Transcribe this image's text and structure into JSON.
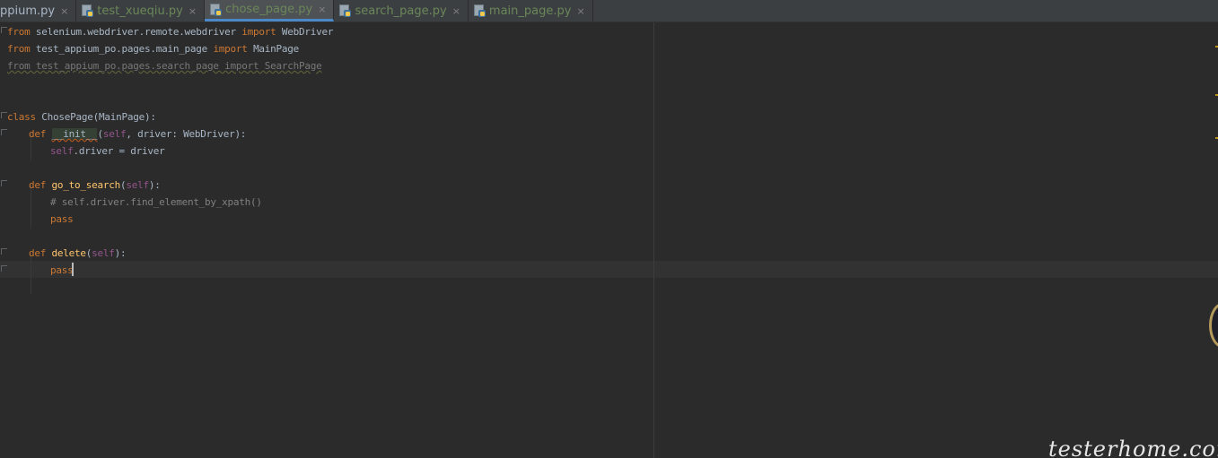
{
  "tabs": [
    {
      "label": "appium.py",
      "active": false,
      "style": "plain"
    },
    {
      "label": "test_xueqiu.py",
      "active": false,
      "style": "green"
    },
    {
      "label": "chose_page.py",
      "active": true,
      "style": "green"
    },
    {
      "label": "search_page.py",
      "active": false,
      "style": "green"
    },
    {
      "label": "main_page.py",
      "active": false,
      "style": "green"
    }
  ],
  "tab_close_glyph": "×",
  "code": {
    "line1": {
      "kw1": "from",
      "module": "selenium.webdriver.remote.webdriver",
      "kw2": "import",
      "name": "WebDriver"
    },
    "line2": {
      "kw1": "from",
      "module": "test_appium_po.pages.main_page",
      "kw2": "import",
      "name": "MainPage"
    },
    "line3": {
      "text": "from test_appium_po.pages.search_page import SearchPage"
    },
    "line6": {
      "kw": "class",
      "name": "ChosePage(MainPage):"
    },
    "line7": {
      "kw": "def",
      "fn": "__init__",
      "open": "(",
      "self": "self",
      "rest": ", driver: WebDriver):"
    },
    "line8": {
      "self": "self",
      "rest": ".driver = driver"
    },
    "line10": {
      "kw": "def",
      "fn": "go_to_search",
      "open": "(",
      "self": "self",
      "close": "):"
    },
    "line11": {
      "comment": "# self.driver.find_element_by_xpath()"
    },
    "line12": {
      "kw": "pass"
    },
    "line14": {
      "kw": "def",
      "fn": "delete",
      "open": "(",
      "self": "self",
      "close": "):"
    },
    "line15": {
      "kw": "pass"
    }
  },
  "watermark": "testerhome.com",
  "colors": {
    "keyword": "#cc7832",
    "self": "#94558d",
    "function": "#ffc66d",
    "comment": "#808080",
    "text": "#a9b7c6",
    "tab_active_underline": "#4a88c7"
  },
  "icons": [
    "python-file-icon",
    "close-icon"
  ]
}
